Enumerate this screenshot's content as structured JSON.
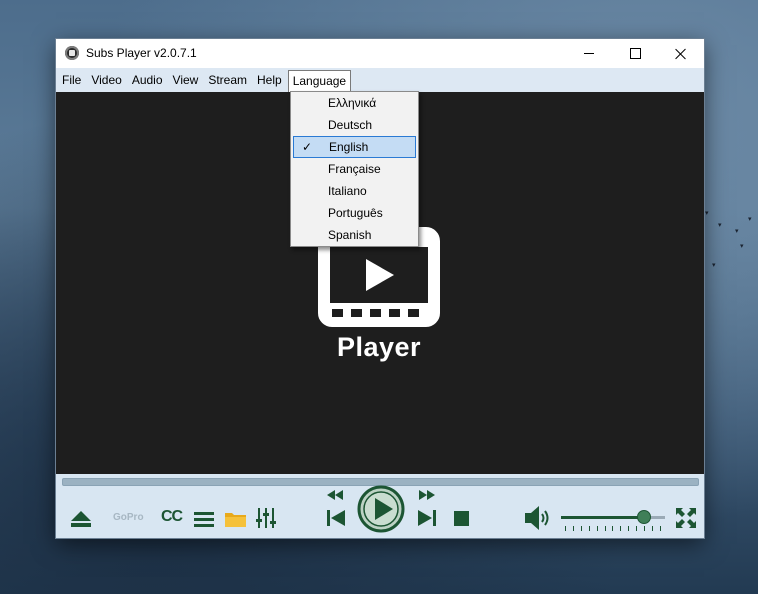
{
  "window": {
    "title": "Subs Player v2.0.7.1"
  },
  "menubar": {
    "items": [
      {
        "label": "File"
      },
      {
        "label": "Video"
      },
      {
        "label": "Audio"
      },
      {
        "label": "View"
      },
      {
        "label": "Stream"
      },
      {
        "label": "Help"
      },
      {
        "label": "Language"
      }
    ],
    "open_menu": "Language"
  },
  "language_menu": {
    "items": [
      {
        "label": "Ελληνικά",
        "checked": false
      },
      {
        "label": "Deutsch",
        "checked": false
      },
      {
        "label": "English",
        "checked": true
      },
      {
        "label": "Française",
        "checked": false
      },
      {
        "label": "Italiano",
        "checked": false
      },
      {
        "label": "Português",
        "checked": false
      },
      {
        "label": "Spanish",
        "checked": false
      }
    ]
  },
  "video": {
    "logo_text": "Player"
  },
  "controls": {
    "gopro_label": "GoPro",
    "cc_label": "CC",
    "volume_level": 0.8,
    "accent_color": "#1c5533",
    "icons": [
      "eject-icon",
      "gopro-icon",
      "cc-icon",
      "playlist-icon",
      "folder-icon",
      "equalizer-icon",
      "rewind-icon",
      "previous-icon",
      "play-icon",
      "fast-forward-icon",
      "next-icon",
      "stop-icon",
      "volume-icon",
      "fullscreen-icon"
    ]
  }
}
